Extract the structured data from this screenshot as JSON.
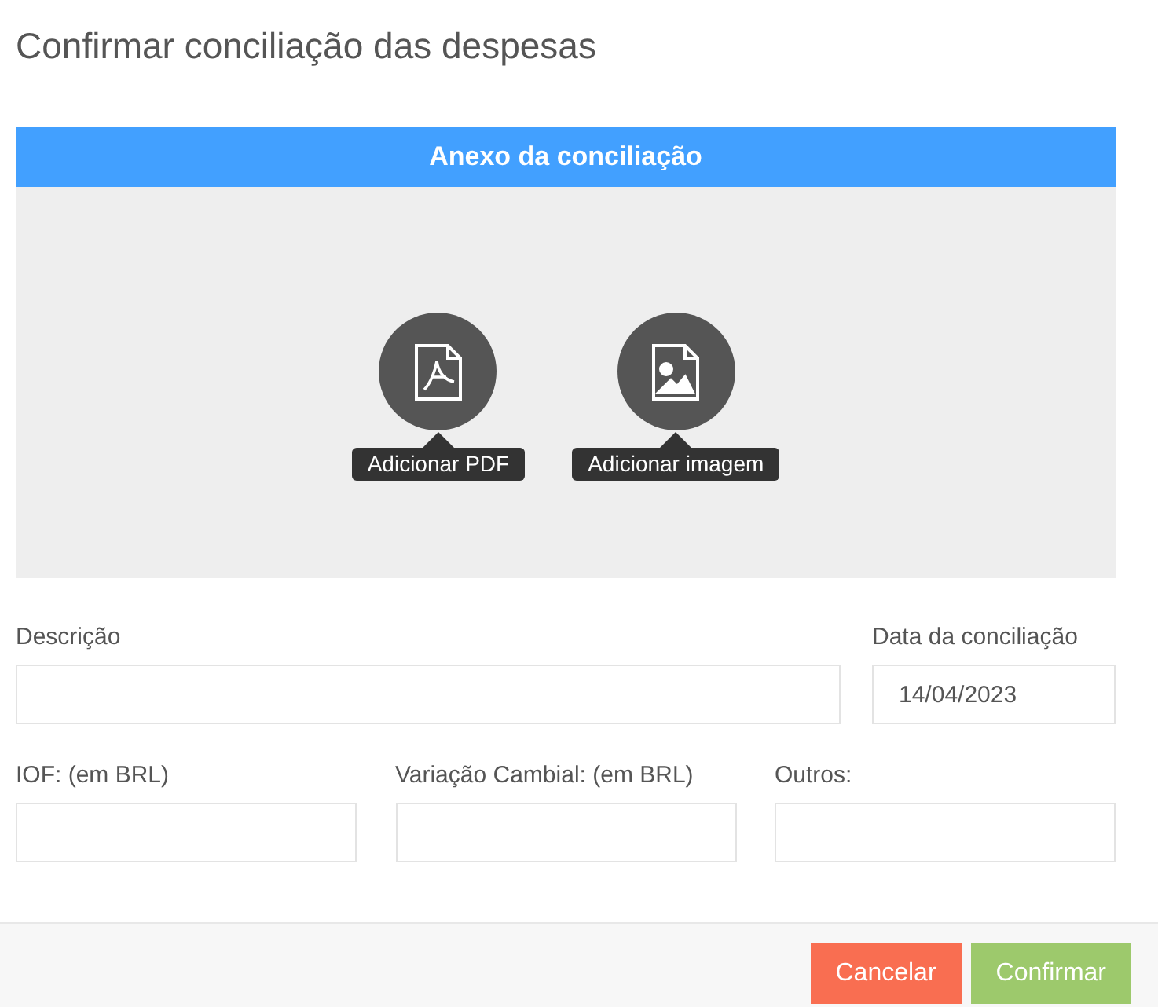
{
  "title": "Confirmar conciliação das despesas",
  "attachment_panel": {
    "header": "Anexo da conciliação",
    "options": [
      {
        "kind": "pdf",
        "tooltip": "Adicionar PDF"
      },
      {
        "kind": "image",
        "tooltip": "Adicionar imagem"
      }
    ]
  },
  "fields_row_1": [
    {
      "label": "Descrição"
    },
    {
      "label": "Data da conciliação",
      "value": "14/04/2023"
    }
  ],
  "fields_row_2": [
    {
      "label": "IOF: (em BRL)"
    },
    {
      "label": "Variação Cambial: (em BRL)"
    },
    {
      "label": "Outros:"
    }
  ],
  "buttons": [
    {
      "kind": "cancel",
      "label": "Cancelar"
    },
    {
      "kind": "confirm",
      "label": "Confirmar"
    }
  ]
}
